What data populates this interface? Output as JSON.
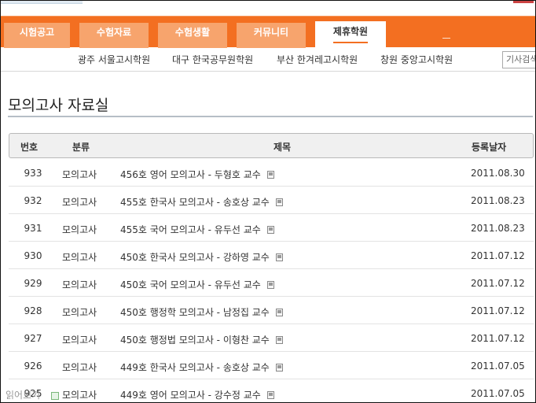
{
  "tabs": [
    {
      "label": "시험공고",
      "active": false
    },
    {
      "label": "수험자료",
      "active": false
    },
    {
      "label": "수험생활",
      "active": false
    },
    {
      "label": "커뮤니티",
      "active": false
    },
    {
      "label": "제휴학원",
      "active": true
    }
  ],
  "subnav": {
    "links": [
      "광주 서울고시학원",
      "대구 한국공무원학원",
      "부산 한겨레고시학원",
      "창원 중앙고시학원"
    ],
    "search_placeholder": "기사검색"
  },
  "page": {
    "title": "모의고사 자료실"
  },
  "table": {
    "headers": {
      "num": "번호",
      "category": "분류",
      "title": "제목",
      "date": "등록날자"
    },
    "rows": [
      {
        "num": "933",
        "category": "모의고사",
        "title": "456호 영어 모의고사 - 두형호 교수",
        "date": "2011.08.30"
      },
      {
        "num": "932",
        "category": "모의고사",
        "title": "455호 한국사 모의고사 - 송호상 교수",
        "date": "2011.08.23"
      },
      {
        "num": "931",
        "category": "모의고사",
        "title": "455호 국어 모의고사 - 유두선 교수",
        "date": "2011.08.23"
      },
      {
        "num": "930",
        "category": "모의고사",
        "title": "450호 한국사 모의고사 - 강하영 교수",
        "date": "2011.07.12"
      },
      {
        "num": "929",
        "category": "모의고사",
        "title": "450호 국어 모의고사 - 유두선 교수",
        "date": "2011.07.12"
      },
      {
        "num": "928",
        "category": "모의고사",
        "title": "450호 행정학 모의고사 - 남정집 교수",
        "date": "2011.07.12"
      },
      {
        "num": "927",
        "category": "모의고사",
        "title": "450호 행정법 모의고사 - 이형찬 교수",
        "date": "2011.07.12"
      },
      {
        "num": "926",
        "category": "모의고사",
        "title": "449호 한국사 모의고사 - 송호상 교수",
        "date": "2011.07.05"
      },
      {
        "num": "925",
        "category": "모의고사",
        "title": "449호 영어 모의고사 - 강수정 교수",
        "date": "2011.07.05"
      }
    ]
  },
  "overlay": {
    "label": "읽어보기"
  },
  "colors": {
    "nav_orange": "#f36f21",
    "tab_inactive": "#f7a46d"
  }
}
